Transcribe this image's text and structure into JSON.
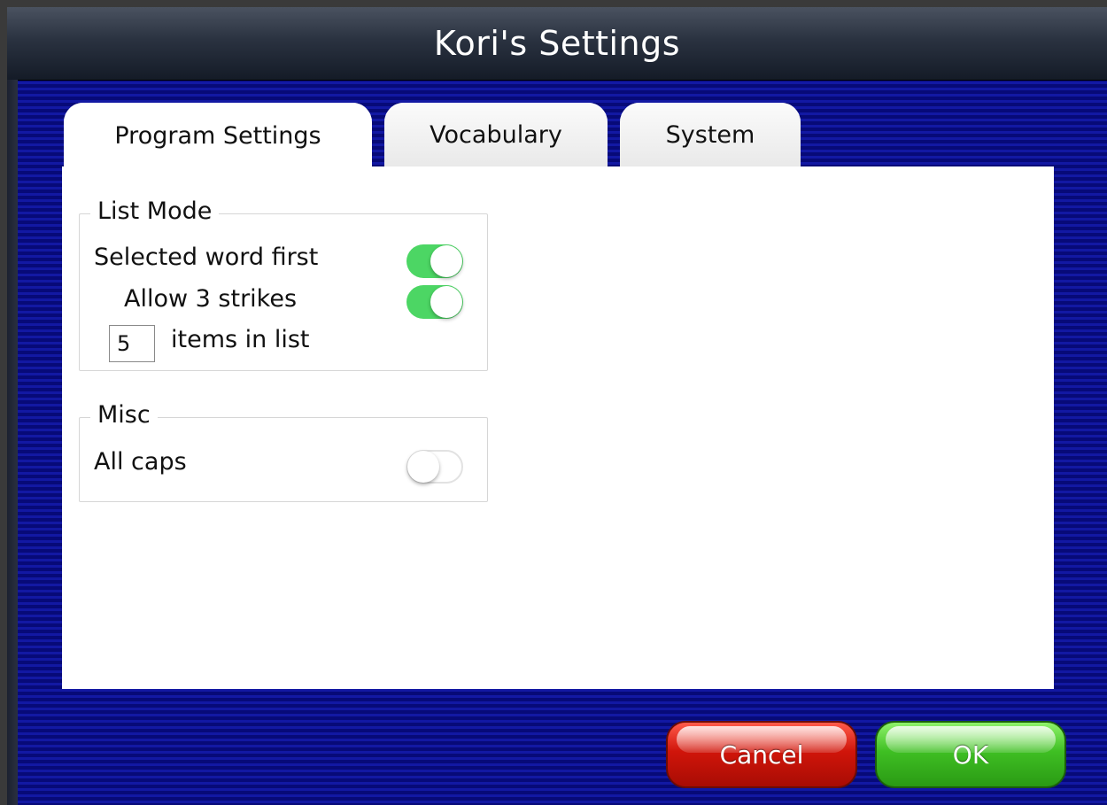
{
  "window": {
    "title": "Kori's Settings"
  },
  "tabs": [
    {
      "label": "Program Settings",
      "active": true
    },
    {
      "label": "Vocabulary",
      "active": false
    },
    {
      "label": "System",
      "active": false
    }
  ],
  "list_mode": {
    "legend": "List Mode",
    "selected_word_first": {
      "label": "Selected word first",
      "on": true
    },
    "allow_3_strikes": {
      "label": "Allow 3 strikes",
      "on": true
    },
    "items_in_list": {
      "value": "5",
      "label": "items in list"
    }
  },
  "misc": {
    "legend": "Misc",
    "all_caps": {
      "label": "All caps",
      "on": false
    }
  },
  "buttons": {
    "cancel": "Cancel",
    "ok": "OK"
  },
  "colors": {
    "background": "#0b0f8c",
    "toggle_on": "#4cd664",
    "cancel_button": "#d0150a",
    "ok_button": "#3fbf23"
  }
}
